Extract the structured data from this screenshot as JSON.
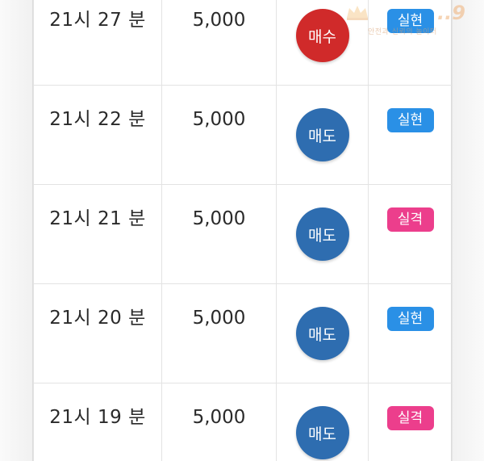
{
  "rows": [
    {
      "time": "21시 27 분",
      "amount": "5,000",
      "type": "매수",
      "result": "실현"
    },
    {
      "time": "21시 22 분",
      "amount": "5,000",
      "type": "매도",
      "result": "실현"
    },
    {
      "time": "21시 21 분",
      "amount": "5,000",
      "type": "매도",
      "result": "실격"
    },
    {
      "time": "21시 20 분",
      "amount": "5,000",
      "type": "매도",
      "result": "실현"
    },
    {
      "time": "21시 19 분",
      "amount": "5,000",
      "type": "매도",
      "result": "실격"
    }
  ],
  "colors": {
    "buy": "#d02a2a",
    "sell": "#2e6db0",
    "hit": "#2a90e6",
    "miss": "#ec3e8c"
  },
  "watermark": {
    "brand": "..9",
    "subtext": "안전과 신뢰의 놀이터"
  }
}
